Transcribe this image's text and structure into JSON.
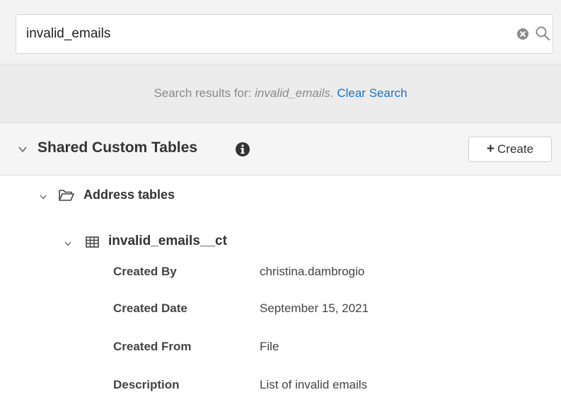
{
  "search": {
    "value": "invalid_emails",
    "clear_icon": "circle-x-icon",
    "search_icon": "magnifier-icon"
  },
  "results_banner": {
    "prefix": "Search results for: ",
    "query": "invalid_emails",
    "suffix": ". ",
    "clear_link": "Clear Search"
  },
  "section": {
    "title": "Shared Custom Tables",
    "info_icon": "info-icon",
    "create_label": "Create",
    "create_icon": "plus-icon"
  },
  "tree": {
    "folder": {
      "label": "Address tables",
      "icon": "folder-icon"
    },
    "table": {
      "label": "invalid_emails__ct",
      "icon": "table-grid-icon"
    }
  },
  "details": [
    {
      "key": "Created By",
      "value": "christina.dambrogio"
    },
    {
      "key": "Created Date",
      "value": "September 15, 2021"
    },
    {
      "key": "Created From",
      "value": "File"
    },
    {
      "key": "Description",
      "value": "List of invalid emails"
    }
  ],
  "colors": {
    "link": "#1a73c8",
    "banner_bg": "#ececec",
    "header_bg": "#f5f5f5",
    "text": "#333333"
  }
}
